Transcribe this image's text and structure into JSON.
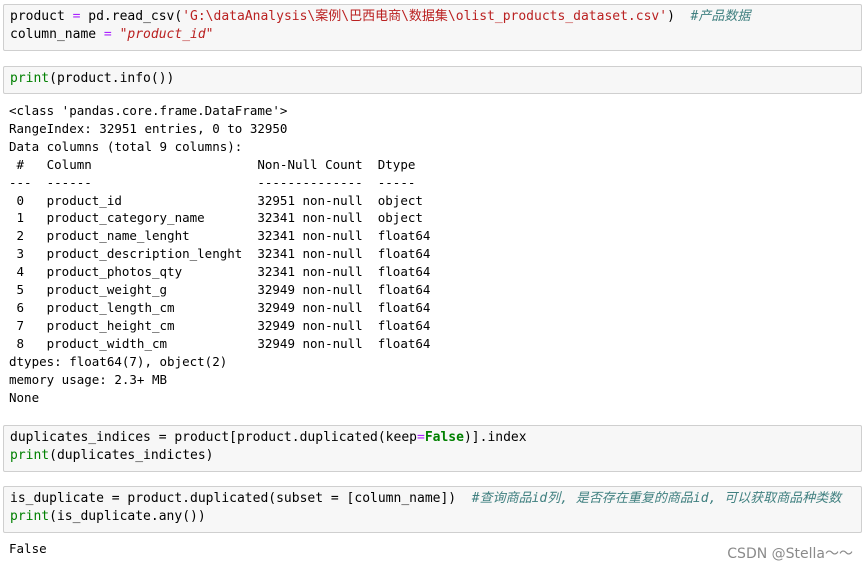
{
  "cells": {
    "c1": {
      "l1": {
        "var": "product",
        "eq": " = ",
        "call": "pd.read_csv(",
        "str": "'G:\\dataAnalysis\\案例\\巴西电商\\数据集\\olist_products_dataset.csv'",
        "close": ")",
        "comment": "#产品数据"
      },
      "l2": {
        "var": "column_name",
        "eq": " = ",
        "str": "\"product_id\""
      }
    },
    "c2": {
      "fn": "print",
      "rest": "(product.info())"
    },
    "c3": {
      "l1": {
        "pre": "duplicates_indices = product[product.duplicated(keep",
        "eq": "=",
        "kw": "False",
        "post": ")].index"
      },
      "l2": {
        "fn": "print",
        "rest": "(duplicates_indictes)"
      }
    },
    "c4": {
      "l1": {
        "pre": "is_duplicate = product.duplicated(subset = [column_name])",
        "comment": "#查询商品id列, 是否存在重复的商品id, 可以获取商品种类数"
      },
      "l2": {
        "fn": "print",
        "rest": "(is_duplicate.any())"
      }
    }
  },
  "output_info": "<class 'pandas.core.frame.DataFrame'>\nRangeIndex: 32951 entries, 0 to 32950\nData columns (total 9 columns):\n #   Column                      Non-Null Count  Dtype  \n---  ------                      --------------  -----  \n 0   product_id                  32951 non-null  object \n 1   product_category_name       32341 non-null  object \n 2   product_name_lenght         32341 non-null  float64\n 3   product_description_lenght  32341 non-null  float64\n 4   product_photos_qty          32341 non-null  float64\n 5   product_weight_g            32949 non-null  float64\n 6   product_length_cm           32949 non-null  float64\n 7   product_height_cm           32949 non-null  float64\n 8   product_width_cm            32949 non-null  float64\ndtypes: float64(7), object(2)\nmemory usage: 2.3+ MB\nNone",
  "output_any": "False",
  "watermark": "CSDN @Stella～～"
}
